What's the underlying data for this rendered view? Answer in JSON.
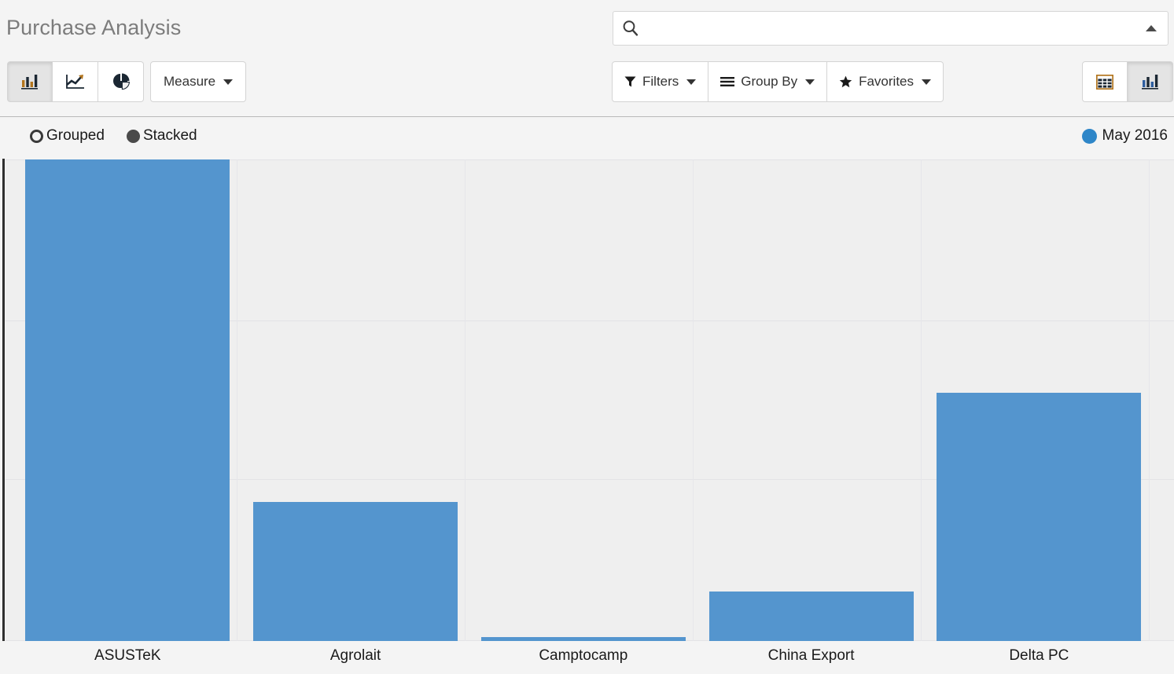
{
  "header": {
    "title": "Purchase Analysis",
    "search": {
      "value": "",
      "placeholder": "",
      "icon": "search-icon",
      "caret_icon": "caret-up-icon"
    }
  },
  "toolbar": {
    "chart_types": [
      {
        "name": "bar-chart-view-button",
        "icon": "bar-chart-icon",
        "active": true
      },
      {
        "name": "line-chart-view-button",
        "icon": "line-chart-icon",
        "active": false
      },
      {
        "name": "pie-chart-view-button",
        "icon": "pie-chart-icon",
        "active": false
      }
    ],
    "measure_label": "Measure",
    "filters_label": "Filters",
    "group_by_label": "Group By",
    "favorites_label": "Favorites",
    "view_switcher": [
      {
        "name": "list-view-button",
        "icon": "table-icon",
        "active": false
      },
      {
        "name": "graph-view-button",
        "icon": "bar-chart-icon",
        "active": true
      }
    ]
  },
  "chart_controls": {
    "modes": [
      {
        "label": "Grouped",
        "selected": false
      },
      {
        "label": "Stacked",
        "selected": true
      }
    ],
    "legend": [
      {
        "label": "May 2016",
        "color": "#2e86c8"
      }
    ]
  },
  "chart_data": {
    "type": "bar",
    "title": "Purchase Analysis",
    "xlabel": "",
    "ylabel": "",
    "grid": true,
    "legend_position": "top-right",
    "stacked": true,
    "categories": [
      "ASUSTeK",
      "Agrolait",
      "Camptocamp",
      "China Export",
      "Delta PC"
    ],
    "series": [
      {
        "name": "May 2016",
        "color": "#5495ce",
        "values": [
          100.0,
          28.8,
          0.8,
          10.3,
          51.5
        ]
      }
    ],
    "ylim": [
      0,
      100
    ],
    "yticks": [],
    "axis_visible": {
      "x": true,
      "y": true
    },
    "bar_geometry": [
      {
        "category": "ASUSTeK",
        "left_pct": 1.7,
        "width_pct": 17.5,
        "height_pct": 100.0
      },
      {
        "category": "Agrolait",
        "left_pct": 21.2,
        "width_pct": 17.5,
        "height_pct": 28.8
      },
      {
        "category": "Camptocamp",
        "left_pct": 40.7,
        "width_pct": 17.5,
        "height_pct": 0.8
      },
      {
        "category": "China Export",
        "left_pct": 60.2,
        "width_pct": 17.5,
        "height_pct": 10.3
      },
      {
        "category": "Delta PC",
        "left_pct": 79.7,
        "width_pct": 17.5,
        "height_pct": 51.5
      }
    ],
    "gridlines_h_pct": [
      0,
      33.5,
      66.5
    ],
    "gridlines_v_pct": [
      19.8,
      39.3,
      58.8,
      78.3,
      97.8
    ]
  },
  "colors": {
    "bar": "#5495ce",
    "legend": "#2e86c8",
    "plot_bg": "#efefef",
    "page_bg": "#f4f4f4",
    "title": "#7c7c7c"
  }
}
